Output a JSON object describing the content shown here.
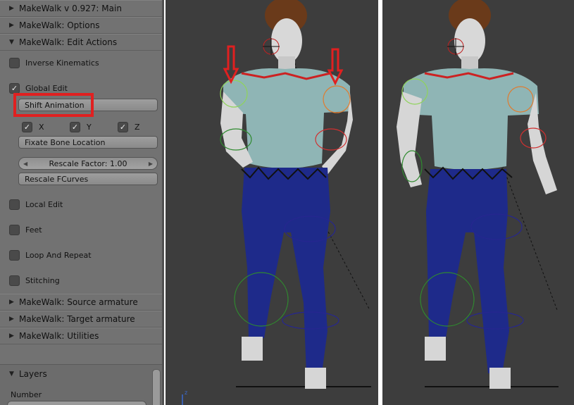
{
  "panel": {
    "sections": {
      "main": {
        "label": "MakeWalk v 0.927: Main",
        "expanded": false
      },
      "options": {
        "label": "MakeWalk: Options",
        "expanded": false
      },
      "edit_actions": {
        "label": "MakeWalk: Edit Actions",
        "expanded": true
      },
      "source_armature": {
        "label": "MakeWalk: Source armature",
        "expanded": false
      },
      "target_armature": {
        "label": "MakeWalk: Target armature",
        "expanded": false
      },
      "utilities": {
        "label": "MakeWalk: Utilities",
        "expanded": false
      },
      "layers": {
        "label": "Layers",
        "expanded": true
      }
    },
    "edit_actions": {
      "inverse_kinematics": {
        "label": "Inverse Kinematics",
        "checked": false
      },
      "global_edit": {
        "label": "Global Edit",
        "checked": true
      },
      "shift_animation_label": "Shift Animation",
      "axes": [
        {
          "label": "X",
          "checked": true
        },
        {
          "label": "Y",
          "checked": true
        },
        {
          "label": "Z",
          "checked": true
        }
      ],
      "fixate_bone_location_label": "Fixate Bone Location",
      "rescale_factor_label": "Rescale Factor: 1.00",
      "rescale_fcurves_label": "Rescale FCurves",
      "local_edit": {
        "label": "Local Edit",
        "checked": false
      },
      "feet": {
        "label": "Feet",
        "checked": false
      },
      "loop_and_repeat": {
        "label": "Loop And Repeat",
        "checked": false
      },
      "stitching": {
        "label": "Stitching",
        "checked": false
      }
    },
    "layers": {
      "number_label": "Number"
    },
    "expanded_icon": "▼",
    "collapsed_icon": "▶",
    "check_glyph": "✓"
  },
  "colors": {
    "panel_bg": "#727272",
    "viewport_bg": "#3d3d3d",
    "highlight": "#e02020",
    "shirt": "#8fb5b5",
    "pants": "#1e2a8a",
    "skin": "#d9d9d9",
    "hair": "#6a3a1a"
  }
}
